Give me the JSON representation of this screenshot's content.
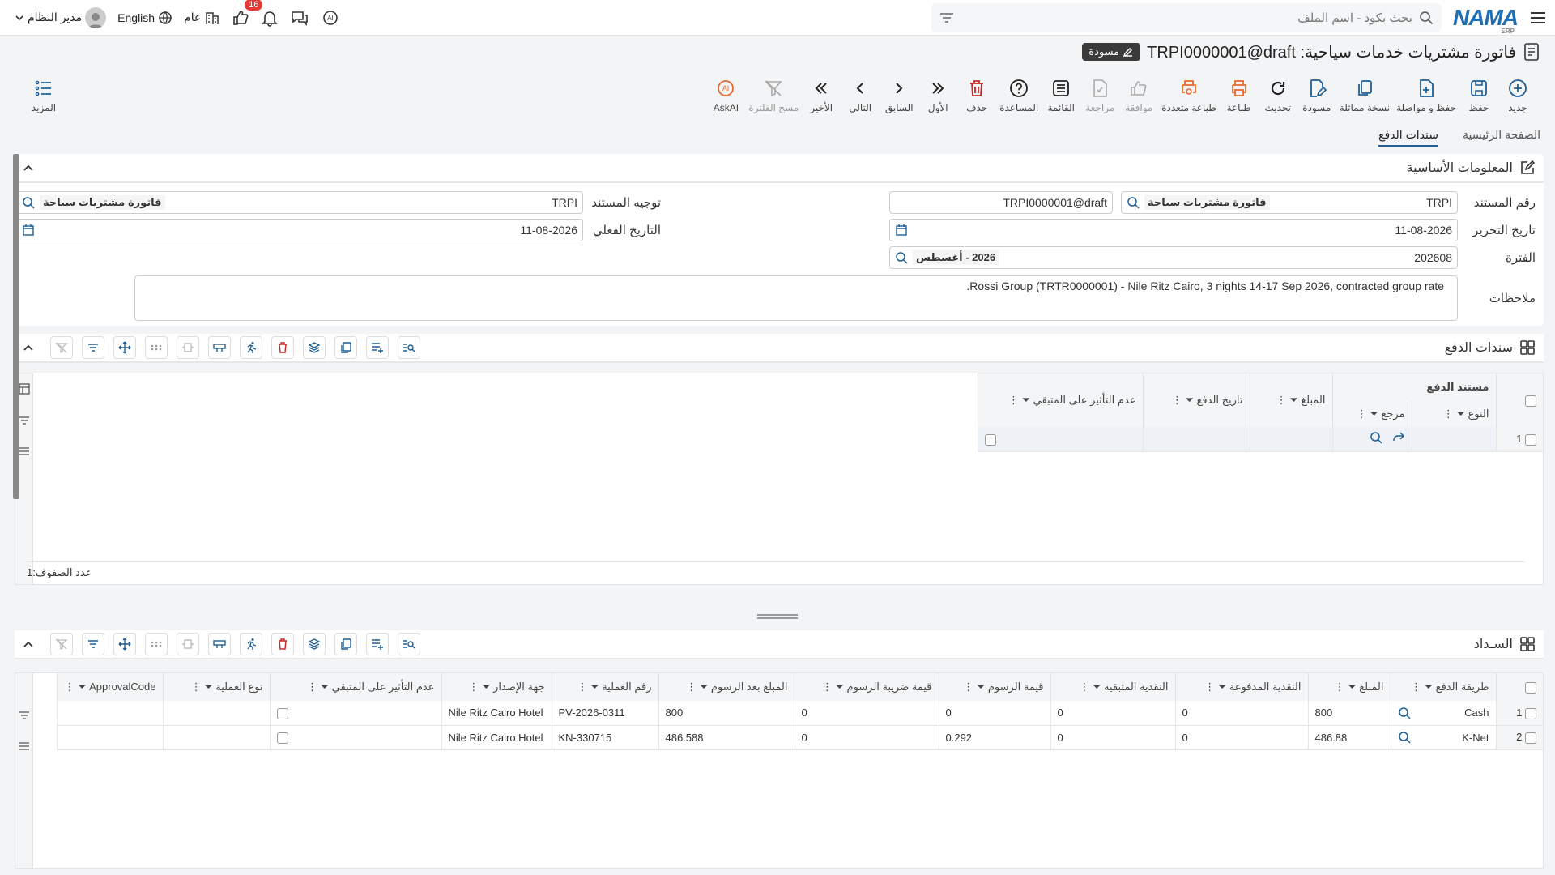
{
  "topbar": {
    "logo": "NAMA",
    "logo_sub": "ERP",
    "search_placeholder": "بحث بكود - اسم الملف",
    "notif_count": "16",
    "general_label": "عام",
    "language_label": "English",
    "user_label": "مدير النظام"
  },
  "page": {
    "title": "فاتورة مشتريات خدمات سياحية: TRPI0000001@draft",
    "status": "مسودة"
  },
  "toolbar": {
    "new": "جديد",
    "save": "حفظ",
    "save_continue": "حفظ و مواصلة",
    "duplicate": "نسخة مماثلة",
    "draft": "مسودة",
    "refresh": "تحديث",
    "print": "طباعة",
    "multi_print": "طباعة متعددة",
    "approve": "موافقة",
    "review": "مراجعة",
    "list": "القائمة",
    "help": "المساعدة",
    "delete": "حذف",
    "first": "الأول",
    "previous": "السابق",
    "next": "التالي",
    "last": "الأخير",
    "clear_filter": "مسح الفلترة",
    "askai": "AskAI",
    "more": "المزيد"
  },
  "tabs": [
    {
      "label": "الصفحة الرئيسية"
    },
    {
      "label": "سندات الدفع"
    }
  ],
  "basic_info": {
    "title": "المعلومات الأساسية",
    "doc_number_label": "رقم المستند",
    "doc_number_code": "TRPI",
    "doc_number_type": "فاتورة مشتريات سياحة",
    "doc_number_value": "TRPI0000001@draft",
    "direction_label": "توجيه المستند",
    "direction_code": "TRPI",
    "direction_type": "فاتورة مشتريات سياحة",
    "edit_date_label": "تاريخ التحرير",
    "edit_date": "11-08-2026",
    "actual_date_label": "التاريخ الفعلي",
    "actual_date": "11-08-2026",
    "period_label": "الفترة",
    "period_code": "202608",
    "period_name": "2026 - أغسطس",
    "notes_label": "ملاحظات",
    "notes": "Rossi Group (TRTR0000001) - Nile Ritz Cairo, 3 nights 14-17 Sep 2026, contracted group rate."
  },
  "payment_vouchers": {
    "title": "سندات الدفع",
    "group_header": "مستند الدفع",
    "columns": {
      "type": "النوع",
      "ref": "مرجع",
      "amount": "المبلغ",
      "pay_date": "تاريخ الدفع",
      "no_effect": "عدم التأثير على المتبقي"
    },
    "rows": [
      {
        "num": "1",
        "type": "",
        "amount": "",
        "pay_date": ""
      }
    ],
    "row_count_label": "عدد الصفوف:",
    "row_count": "1"
  },
  "settlement": {
    "title": "السـداد",
    "columns": [
      "طريقة الدفع",
      "المبلغ",
      "النقدية المدفوعة",
      "النقديه المتبقيه",
      "قيمة الرسوم",
      "قيمة ضريبة الرسوم",
      "المبلغ بعد الرسوم",
      "رقم العملية",
      "جهة الإصدار",
      "عدم التأثير على المتبقي",
      "نوع العملية",
      "ApprovalCode"
    ],
    "rows": [
      {
        "num": "1",
        "method": "Cash",
        "amount": "800",
        "paid": "0",
        "remaining": "0",
        "fees": "0",
        "fees_tax": "0",
        "after_fees": "800",
        "op_no": "PV-2026-0311",
        "issuer": "Nile Ritz Cairo Hotel",
        "op_type": "",
        "approval": ""
      },
      {
        "num": "2",
        "method": "K-Net",
        "amount": "486.88",
        "paid": "0",
        "remaining": "0",
        "fees": "0.292",
        "fees_tax": "0",
        "after_fees": "486.588",
        "op_no": "KN-330715",
        "issuer": "Nile Ritz Cairo Hotel",
        "op_type": "",
        "approval": ""
      }
    ]
  },
  "colors": {
    "primary": "#1f5f95",
    "accent_red": "#e53935",
    "orange": "#e8692e"
  }
}
